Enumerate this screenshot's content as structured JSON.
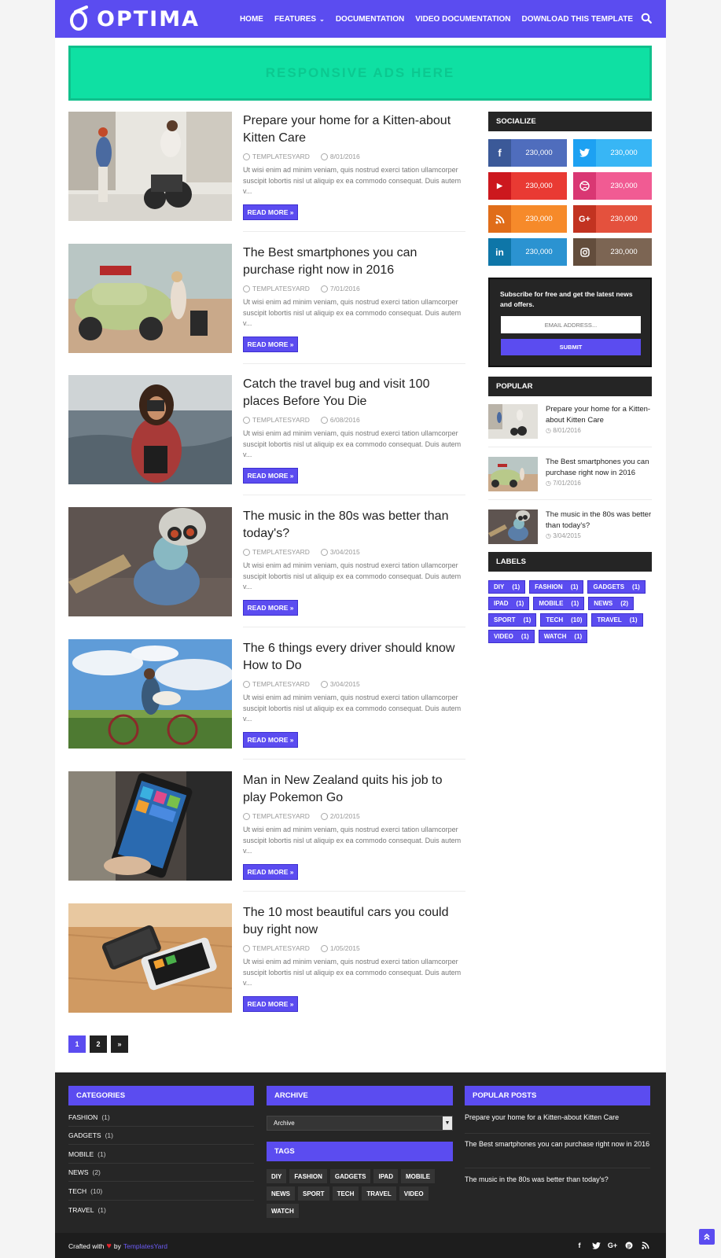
{
  "header": {
    "logo_text": "OPTIMA",
    "nav": [
      {
        "label": "HOME"
      },
      {
        "label": "FEATURES",
        "has_dropdown": true
      },
      {
        "label": "DOCUMENTATION"
      },
      {
        "label": "VIDEO DOCUMENTATION"
      },
      {
        "label": "DOWNLOAD THIS TEMPLATE"
      }
    ],
    "search_icon": "search-icon"
  },
  "ad": {
    "text": "RESPONSIVE ADS HERE"
  },
  "posts": [
    {
      "title": "Prepare your home for a Kitten-about Kitten Care",
      "author": "TEMPLATESYARD",
      "date": "8/01/2016",
      "excerpt": "Ut wisi enim ad minim veniam, quis nostrud exerci tation ullamcorper suscipit lobortis nisl ut aliquip ex ea commodo consequat. Duis autem v...",
      "read_more": "READ MORE »"
    },
    {
      "title": "The Best smartphones you can purchase right now in 2016",
      "author": "TEMPLATESYARD",
      "date": "7/01/2016",
      "excerpt": "Ut wisi enim ad minim veniam, quis nostrud exerci tation ullamcorper suscipit lobortis nisl ut aliquip ex ea commodo consequat. Duis autem v...",
      "read_more": "READ MORE »"
    },
    {
      "title": "Catch the travel bug and visit 100 places Before You Die",
      "author": "TEMPLATESYARD",
      "date": "6/08/2016",
      "excerpt": "Ut wisi enim ad minim veniam, quis nostrud exerci tation ullamcorper suscipit lobortis nisl ut aliquip ex ea commodo consequat. Duis autem v...",
      "read_more": "READ MORE »"
    },
    {
      "title": "The music in the 80s was better than today's?",
      "author": "TEMPLATESYARD",
      "date": "3/04/2015",
      "excerpt": "Ut wisi enim ad minim veniam, quis nostrud exerci tation ullamcorper suscipit lobortis nisl ut aliquip ex ea commodo consequat. Duis autem v...",
      "read_more": "READ MORE »"
    },
    {
      "title": "The 6 things every driver should know How to Do",
      "author": "TEMPLATESYARD",
      "date": "3/04/2015",
      "excerpt": "Ut wisi enim ad minim veniam, quis nostrud exerci tation ullamcorper suscipit lobortis nisl ut aliquip ex ea commodo consequat. Duis autem v...",
      "read_more": "READ MORE »"
    },
    {
      "title": "Man in New Zealand quits his job to play Pokemon Go",
      "author": "TEMPLATESYARD",
      "date": "2/01/2015",
      "excerpt": "Ut wisi enim ad minim veniam, quis nostrud exerci tation ullamcorper suscipit lobortis nisl ut aliquip ex ea commodo consequat. Duis autem v...",
      "read_more": "READ MORE »"
    },
    {
      "title": "The 10 most beautiful cars you could buy right now",
      "author": "TEMPLATESYARD",
      "date": "1/05/2015",
      "excerpt": "Ut wisi enim ad minim veniam, quis nostrud exerci tation ullamcorper suscipit lobortis nisl ut aliquip ex ea commodo consequat. Duis autem v...",
      "read_more": "READ MORE »"
    }
  ],
  "pagination": {
    "pages": [
      "1",
      "2"
    ],
    "next": "»",
    "current": "1"
  },
  "sidebar": {
    "socialize_title": "SOCIALIZE",
    "social": [
      {
        "name": "facebook",
        "icon": "f",
        "count": "230,000",
        "color_icon": "#3b5998",
        "color_bg": "#4f6dbd"
      },
      {
        "name": "twitter",
        "icon": "t",
        "count": "230,000",
        "color_icon": "#1da1f2",
        "color_bg": "#38b6f5"
      },
      {
        "name": "youtube",
        "icon": "▶",
        "count": "230,000",
        "color_icon": "#cc181e",
        "color_bg": "#e93a33"
      },
      {
        "name": "dribbble",
        "icon": "◎",
        "count": "230,000",
        "color_icon": "#d93773",
        "color_bg": "#f15b93"
      },
      {
        "name": "rss",
        "icon": ")",
        "count": "230,000",
        "color_icon": "#e06d19",
        "color_bg": "#f68a2a"
      },
      {
        "name": "google-plus",
        "icon": "G+",
        "count": "230,000",
        "color_icon": "#c23321",
        "color_bg": "#e4513d"
      },
      {
        "name": "linkedin",
        "icon": "in",
        "count": "230,000",
        "color_icon": "#0e76a8",
        "color_bg": "#2b93d1"
      },
      {
        "name": "instagram",
        "icon": "◻",
        "count": "230,000",
        "color_icon": "#634d3c",
        "color_bg": "#7c6553"
      }
    ],
    "subscribe": {
      "text": "Subscribe for free and get the latest news and offers.",
      "placeholder": "EMAIL ADDRESS...",
      "button": "SUBMIT"
    },
    "popular_title": "POPULAR",
    "popular": [
      {
        "title": "Prepare your home for a Kitten-about Kitten Care",
        "date": "8/01/2016"
      },
      {
        "title": "The Best smartphones you can purchase right now in 2016",
        "date": "7/01/2016"
      },
      {
        "title": "The music in the 80s was better than today's?",
        "date": "3/04/2015"
      }
    ],
    "labels_title": "LABELS",
    "labels": [
      {
        "name": "DIY",
        "count": "(1)"
      },
      {
        "name": "FASHION",
        "count": "(1)"
      },
      {
        "name": "GADGETS",
        "count": "(1)"
      },
      {
        "name": "IPAD",
        "count": "(1)"
      },
      {
        "name": "MOBILE",
        "count": "(1)"
      },
      {
        "name": "NEWS",
        "count": "(2)"
      },
      {
        "name": "SPORT",
        "count": "(1)"
      },
      {
        "name": "TECH",
        "count": "(10)"
      },
      {
        "name": "TRAVEL",
        "count": "(1)"
      },
      {
        "name": "VIDEO",
        "count": "(1)"
      },
      {
        "name": "WATCH",
        "count": "(1)"
      }
    ]
  },
  "footer": {
    "categories_title": "CATEGORIES",
    "categories": [
      {
        "name": "FASHION",
        "count": "(1)"
      },
      {
        "name": "GADGETS",
        "count": "(1)"
      },
      {
        "name": "MOBILE",
        "count": "(1)"
      },
      {
        "name": "NEWS",
        "count": "(2)"
      },
      {
        "name": "TECH",
        "count": "(10)"
      },
      {
        "name": "TRAVEL",
        "count": "(1)"
      }
    ],
    "archive_title": "ARCHIVE",
    "archive_select": "Archive",
    "tags_title": "TAGS",
    "tags": [
      "DIY",
      "FASHION",
      "GADGETS",
      "IPAD",
      "MOBILE",
      "NEWS",
      "SPORT",
      "TECH",
      "TRAVEL",
      "VIDEO",
      "WATCH"
    ],
    "popular_title": "POPULAR POSTS",
    "popular": [
      "Prepare your home for a Kitten-about Kitten Care",
      "The Best smartphones you can purchase right now in 2016",
      "The music in the 80s was better than today's?"
    ],
    "credit_prefix": "Crafted with",
    "credit_by": "by",
    "credit_link": "TemplatesYard",
    "social_icons": [
      "facebook-icon",
      "twitter-icon",
      "google-plus-icon",
      "pinterest-icon",
      "rss-icon"
    ]
  },
  "colors": {
    "accent": "#5b4cf0",
    "dark": "#252525",
    "ad_bg": "#0fe0a3"
  }
}
